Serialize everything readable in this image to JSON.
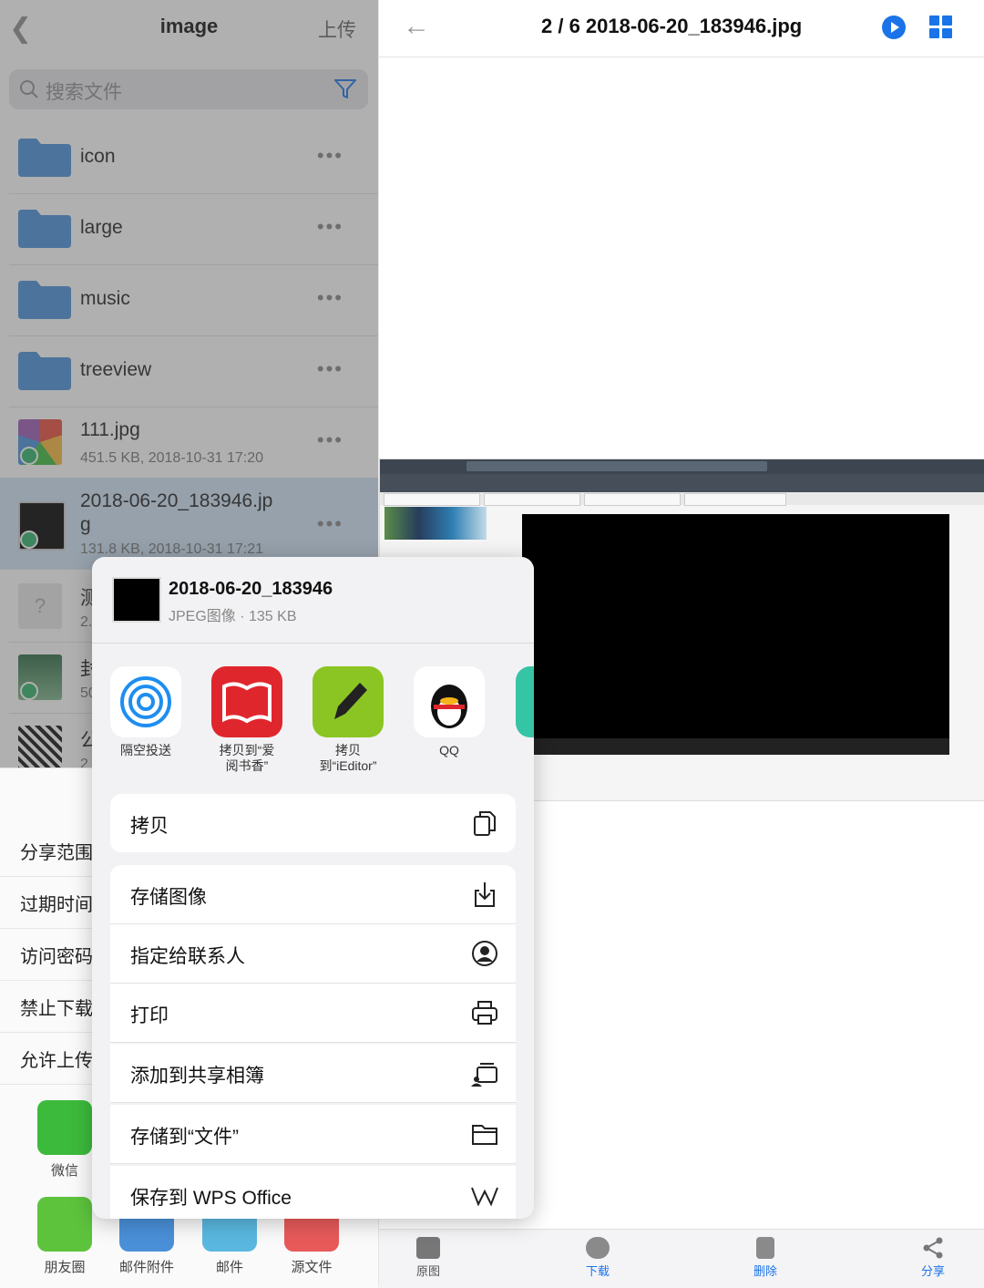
{
  "left": {
    "header": {
      "title": "image",
      "upload_label": "上传"
    },
    "search": {
      "placeholder": "搜索文件"
    },
    "folders": [
      {
        "name": "icon"
      },
      {
        "name": "large"
      },
      {
        "name": "music"
      },
      {
        "name": "treeview"
      }
    ],
    "files": [
      {
        "name": "111.jpg",
        "meta": "451.5 KB, 2018-10-31 17:20"
      },
      {
        "name_line1": "2018-06-20_183946.jp",
        "name_line2": "g",
        "meta": "131.8 KB, 2018-10-31 17:21"
      }
    ],
    "partial_rows": [
      {
        "name": "测",
        "meta": "2."
      },
      {
        "name": "封",
        "meta": "50"
      },
      {
        "name": "公",
        "meta": "2"
      }
    ],
    "share_settings": [
      "分享范围",
      "过期时间",
      "访问密码",
      "禁止下载",
      "允许上传"
    ],
    "share_apps": [
      "微信",
      "朋友圈",
      "邮件附件",
      "邮件",
      "源文件"
    ]
  },
  "right": {
    "header": {
      "title": "2 / 6  2018-06-20_183946.jpg"
    },
    "toolbar": [
      "原图",
      "下载",
      "删除",
      "分享"
    ]
  },
  "sheet": {
    "file_name": "2018-06-20_183946",
    "file_info": "JPEG图像 · 135 KB",
    "apps": [
      {
        "label": "隔空投送",
        "icon": "airdrop-icon"
      },
      {
        "label": "拷贝到“爱\n阅书香”",
        "icon": "book-app-icon"
      },
      {
        "label": "拷贝\n到“iEditor”",
        "icon": "ieditor-icon"
      },
      {
        "label": "QQ",
        "icon": "qq-icon"
      }
    ],
    "actions": [
      {
        "label": "拷贝",
        "icon": "copy-icon"
      },
      {
        "label": "存储图像",
        "icon": "save-image-icon"
      },
      {
        "label": "指定给联系人",
        "icon": "contact-icon"
      },
      {
        "label": "打印",
        "icon": "print-icon"
      },
      {
        "label": "添加到共享相簿",
        "icon": "shared-album-icon"
      },
      {
        "label": "存储到“文件”",
        "icon": "folder-icon"
      },
      {
        "label": "保存到 WPS Office",
        "icon": "wps-icon"
      }
    ]
  },
  "colors": {
    "accent": "#1a73e8",
    "folder": "#4a90d9",
    "wechat": "#3cba3c",
    "selected_row": "#cfe3f7"
  }
}
